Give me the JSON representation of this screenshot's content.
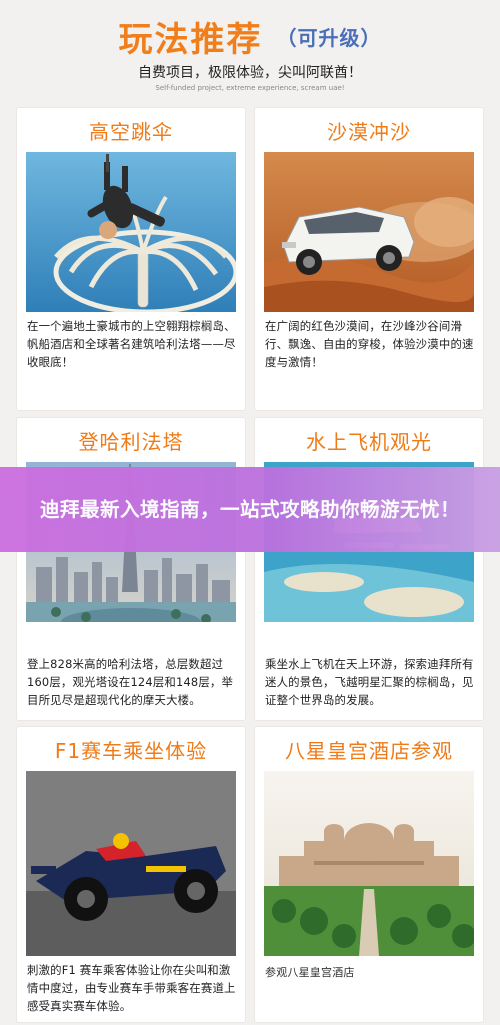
{
  "header": {
    "title": "玩法推荐",
    "tag": "（可升级）",
    "subtitle": "自费项目，极限体验，尖叫阿联酋！",
    "subtitle_en": "Self-funded project, extreme experience, scream uae!"
  },
  "cards": [
    {
      "title": "高空跳伞",
      "image": "skydiving-over-palm-island-photo",
      "desc": "在一个遍地土豪城市的上空翱翔棕榈岛、帆船酒店和全球著名建筑哈利法塔——尽收眼底！"
    },
    {
      "title": "沙漠冲沙",
      "image": "suv-desert-dune-bashing-photo",
      "desc": "在广阔的红色沙漠间，在沙峰沙谷间滑行、飘逸、自由的穿梭，体验沙漠中的速度与激情！"
    },
    {
      "title": "登哈利法塔",
      "image": "burj-khalifa-skyline-photo",
      "desc": "登上828米高的哈利法塔，总层数超过160层，观光塔设在124层和148层，举目所见尽是超现代化的摩天大楼。"
    },
    {
      "title": "水上飞机观光",
      "image": "seaplane-over-palm-island-photo",
      "desc": "乘坐水上飞机在天上环游，探索迪拜所有迷人的景色，飞越明星汇聚的棕榈岛，见证整个世界岛的发展。"
    },
    {
      "title": "F1赛车乘坐体验",
      "image": "f1-race-car-photo",
      "desc": "刺激的F1 赛车乘客体验让你在尖叫和激情中度过，由专业赛车手带乘客在赛道上感受真实赛车体验。"
    },
    {
      "title": "八星皇宫酒店参观",
      "image": "emirates-palace-hotel-photo",
      "desc": "参观八星皇宫酒店"
    }
  ],
  "banner": {
    "text": "迪拜最新入境指南，一站式攻略助你畅游无忧！"
  },
  "colors": {
    "accent_orange": "#ef7b18",
    "tag_blue": "#4a6fb8",
    "banner_purple": "#c56fe0",
    "background": "#f3f1ef"
  }
}
